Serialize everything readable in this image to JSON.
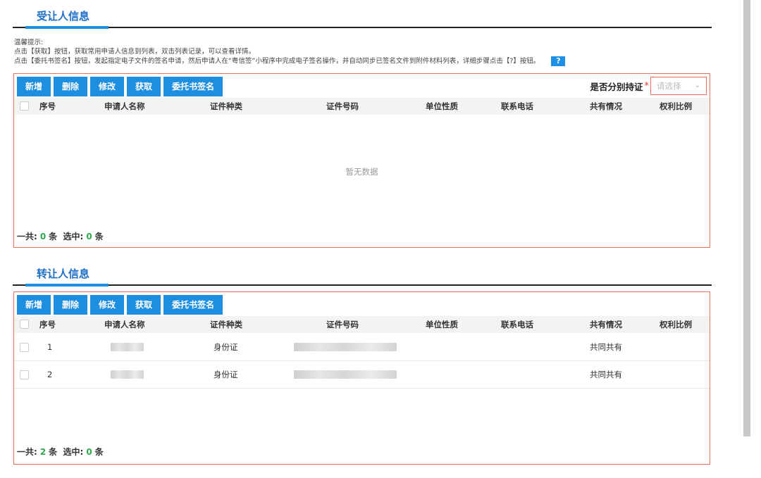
{
  "sections": {
    "assignee": {
      "title": "受让人信息",
      "buttons": [
        "新增",
        "删除",
        "修改",
        "获取",
        "委托书签名"
      ],
      "select_label": "是否分别持证",
      "select_required": "*",
      "select_placeholder": "请选择",
      "columns": [
        "序号",
        "申请人名称",
        "证件种类",
        "证件号码",
        "单位性质",
        "联系电话",
        "共有情况",
        "权利比例"
      ],
      "empty_text": "暂无数据",
      "footer": {
        "total_label": "一共:",
        "total": "0",
        "unit": "条",
        "selected_label": "选中:",
        "selected": "0"
      }
    },
    "assignor": {
      "title": "转让人信息",
      "buttons": [
        "新增",
        "删除",
        "修改",
        "获取",
        "委托书签名"
      ],
      "columns": [
        "序号",
        "申请人名称",
        "证件种类",
        "证件号码",
        "单位性质",
        "联系电话",
        "共有情况",
        "权利比例"
      ],
      "rows": [
        {
          "index": "1",
          "id_type": "身份证",
          "ownership": "共同共有"
        },
        {
          "index": "2",
          "id_type": "身份证",
          "ownership": "共同共有"
        }
      ],
      "footer": {
        "total_label": "一共:",
        "total": "2",
        "unit": "条",
        "selected_label": "选中:",
        "selected": "0"
      }
    }
  },
  "tips": {
    "heading": "温馨提示:",
    "line1": "点击【获取】按钮，获取常用申请人信息到列表，双击列表记录，可以查看详情。",
    "line2": "点击【委托书签名】按钮，发起指定电子文件的签名申请，然后申请人在“粤信签”小程序中完成电子签名操作，并自动同步已签名文件到附件材料列表，详细步骤点击【?】按钮。",
    "help_label": "?"
  }
}
